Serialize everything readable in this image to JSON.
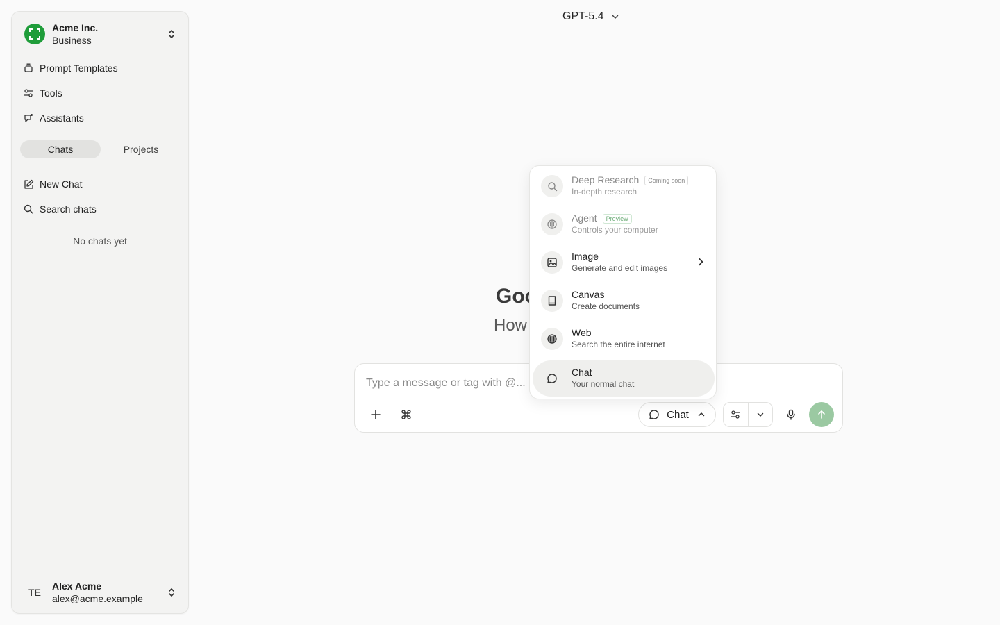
{
  "sidebar": {
    "org": {
      "name": "Acme Inc.",
      "plan": "Business"
    },
    "nav": [
      {
        "label": "Prompt Templates",
        "icon": "stack-icon"
      },
      {
        "label": "Tools",
        "icon": "sliders-icon"
      },
      {
        "label": "Assistants",
        "icon": "assistant-icon"
      }
    ],
    "tabs": {
      "chats": "Chats",
      "projects": "Projects"
    },
    "actions": {
      "new_chat": "New Chat",
      "search_chats": "Search chats"
    },
    "empty_note": "No chats yet",
    "user": {
      "initials": "TE",
      "name": "Alex Acme",
      "email": "alex@acme.example"
    }
  },
  "header": {
    "model": "GPT-5.4"
  },
  "greeting": {
    "title": "Goo",
    "subtitle": "How"
  },
  "composer": {
    "placeholder": "Type a message or tag with @...",
    "mode_label": "Chat"
  },
  "menu": {
    "items": [
      {
        "title": "Deep Research",
        "desc": "In-depth research",
        "badge": "Coming soon",
        "icon": "search-icon",
        "disabled": true
      },
      {
        "title": "Agent",
        "desc": "Controls your computer",
        "badge": "Preview",
        "icon": "agent-icon",
        "disabled": true
      },
      {
        "title": "Image",
        "desc": "Generate and edit images",
        "icon": "image-icon",
        "has_submenu": true
      },
      {
        "title": "Canvas",
        "desc": "Create documents",
        "icon": "book-icon"
      },
      {
        "title": "Web",
        "desc": "Search the entire internet",
        "icon": "globe-icon"
      },
      {
        "title": "Chat",
        "desc": "Your normal chat",
        "icon": "chat-bubble-icon",
        "selected": true
      }
    ]
  },
  "colors": {
    "brand": "#1f9d3a",
    "send_disabled": "#9bc9a2"
  }
}
